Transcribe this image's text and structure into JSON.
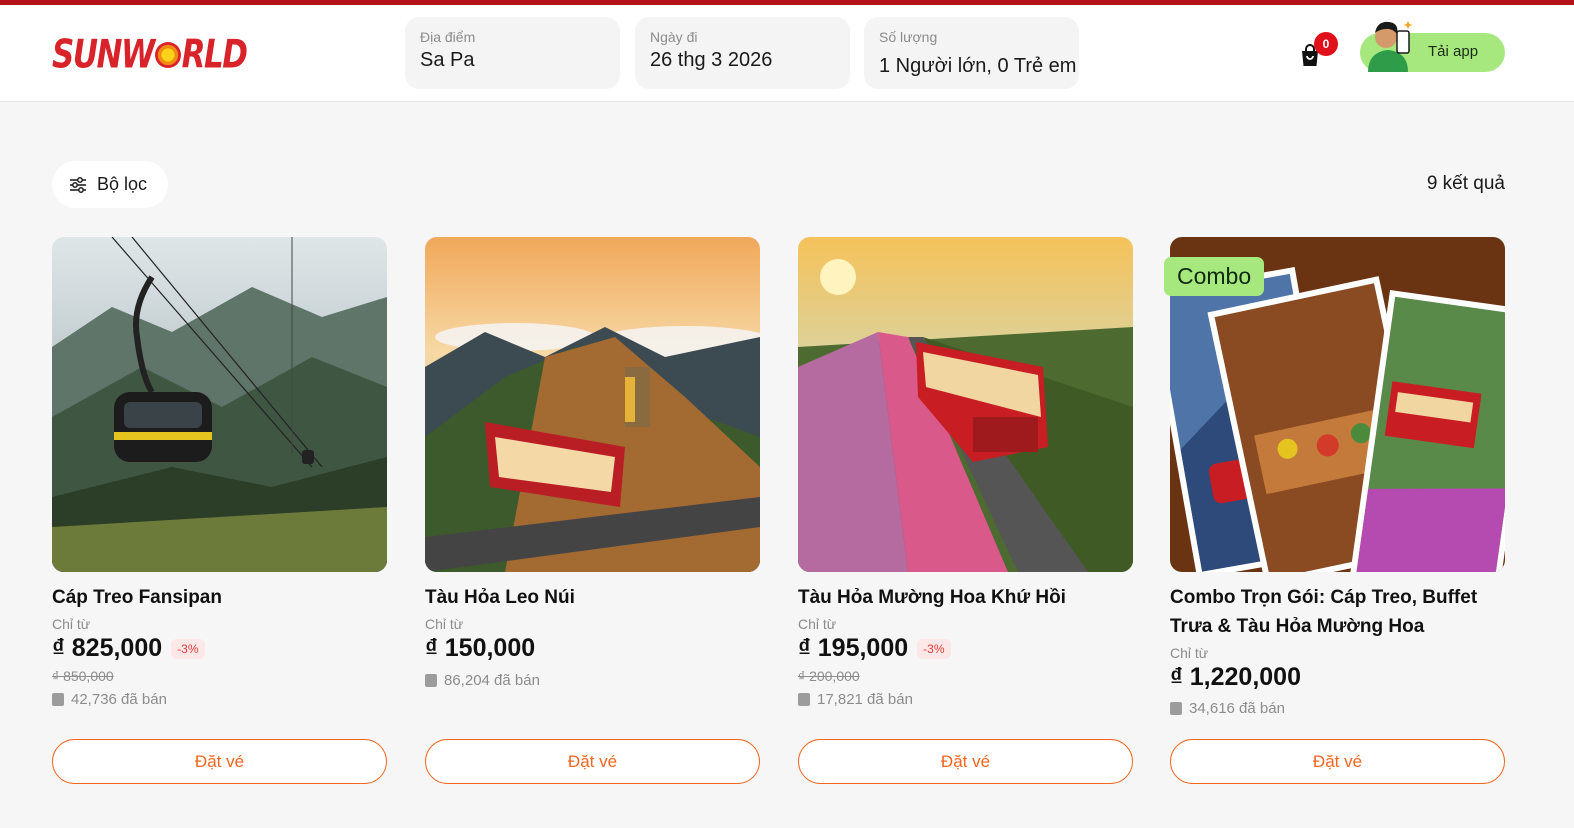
{
  "brand": {
    "logo_text": "SUNWORLD",
    "accent": "#b3121b",
    "book_color": "#f2661f"
  },
  "search": {
    "location": {
      "label": "Địa điểm",
      "value": "Sa Pa"
    },
    "date": {
      "label": "Ngày đi",
      "value": "26 thg 3 2026"
    },
    "quantity": {
      "label": "Số lượng",
      "value": "1 Người lớn, 0 Trẻ em"
    }
  },
  "cart": {
    "count": "0"
  },
  "app_button": {
    "label": "Tải app"
  },
  "filter": {
    "label": "Bộ lọc"
  },
  "results": {
    "label": "9 kết quả"
  },
  "products": [
    {
      "title": "Cáp Treo Fansipan",
      "from": "Chỉ từ",
      "price": "₫ 825,000",
      "discount": "-3%",
      "old_price": "₫ 850,000",
      "sold": "42,736 đã bán",
      "book": "Đặt vé"
    },
    {
      "title": "Tàu Hỏa Leo Núi",
      "from": "Chỉ từ",
      "price": "₫ 150,000",
      "sold": "86,204 đã bán",
      "book": "Đặt vé"
    },
    {
      "title": "Tàu Hỏa Mường Hoa Khứ Hồi",
      "from": "Chỉ từ",
      "price": "₫ 195,000",
      "discount": "-3%",
      "old_price": "₫ 200,000",
      "sold": "17,821 đã bán",
      "book": "Đặt vé"
    },
    {
      "title": "Combo Trọn Gói: Cáp Treo, Buffet Trưa & Tàu Hỏa Mường Hoa",
      "tag": "Combo",
      "from": "Chỉ từ",
      "price": "₫ 1,220,000",
      "sold": "34,616 đã bán",
      "book": "Đặt vé"
    }
  ]
}
